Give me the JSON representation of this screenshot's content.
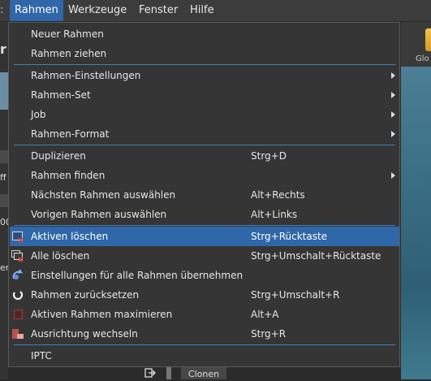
{
  "menubar": {
    "edge": ":",
    "items": [
      "Rahmen",
      "Werkzeuge",
      "Fenster",
      "Hilfe"
    ],
    "active_index": 0
  },
  "background": {
    "left_fragments": [
      "r",
      "ff",
      "er",
      "00"
    ],
    "right_label": "Glo",
    "clone_button": "Clonen"
  },
  "menu": {
    "items": [
      {
        "label": "Neuer Rahmen"
      },
      {
        "label": "Rahmen ziehen"
      },
      {
        "label": "Rahmen-Einstellungen",
        "submenu": true
      },
      {
        "label": "Rahmen-Set",
        "submenu": true
      },
      {
        "label": "Job",
        "submenu": true
      },
      {
        "label": "Rahmen-Format",
        "submenu": true
      },
      {
        "label": "Duplizieren",
        "shortcut": "Strg+D"
      },
      {
        "label": "Rahmen finden",
        "submenu": true
      },
      {
        "label": "Nächsten Rahmen auswählen",
        "shortcut": "Alt+Rechts"
      },
      {
        "label": "Vorigen Rahmen auswählen",
        "shortcut": "Alt+Links"
      },
      {
        "label": "Aktiven löschen",
        "shortcut": "Strg+Rücktaste",
        "icon": "delete-frame-icon",
        "highlighted": true
      },
      {
        "label": "Alle löschen",
        "shortcut": "Strg+Umschalt+Rücktaste",
        "icon": "delete-all-icon"
      },
      {
        "label": "Einstellungen für alle Rahmen übernehmen",
        "icon": "apply-all-icon"
      },
      {
        "label": "Rahmen zurücksetzen",
        "shortcut": "Strg+Umschalt+R",
        "icon": "reset-icon"
      },
      {
        "label": "Aktiven Rahmen maximieren",
        "shortcut": "Alt+A",
        "icon": "maximize-icon"
      },
      {
        "label": "Ausrichtung wechseln",
        "shortcut": "Strg+R",
        "icon": "orientation-icon"
      },
      {
        "label": "IPTC"
      }
    ]
  }
}
